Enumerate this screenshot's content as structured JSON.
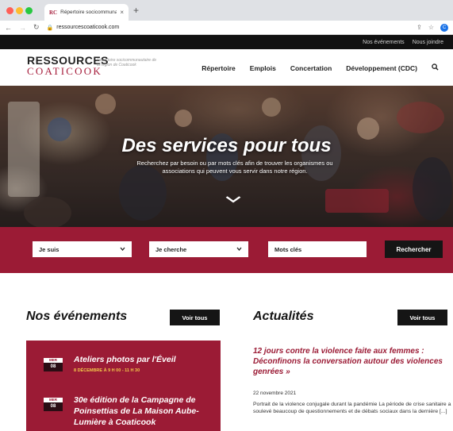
{
  "browser": {
    "tab_favicon": "RC",
    "tab_title": "Répertoire socicommunautai",
    "tab_close": "×",
    "new_tab": "+",
    "url": "ressourcescoaticook.com",
    "profile_initial": "C"
  },
  "topbar": {
    "links": [
      "Nos événements",
      "Nous joindre"
    ]
  },
  "logo": {
    "main": "RESSOURCES",
    "sub": "COATICOOK",
    "tagline": "Répertoire socicommunautaire de la région de Coaticook"
  },
  "nav": {
    "items": [
      "Répertoire",
      "Emplois",
      "Concertation",
      "Développement (CDC)"
    ]
  },
  "hero": {
    "title": "Des services pour tous",
    "subtitle": "Recherchez par besoin ou par mots clés afin de trouver les organismes ou associations qui peuvent vous servir dans notre région."
  },
  "search": {
    "select1": "Je suis",
    "select2": "Je cherche",
    "keywords_placeholder": "Mots clés",
    "button": "Rechercher"
  },
  "events": {
    "title": "Nos événements",
    "see_all": "Voir tous",
    "items": [
      {
        "month": "MER",
        "day": "08",
        "title": "Ateliers photos par l'Éveil",
        "date": "8 DÉCEMBRE À 9 H 00 - 11 H 30"
      },
      {
        "month": "MER",
        "day": "08",
        "title": "30e édition de la Campagne de Poinsettias de La Maison Aube-Lumière à Coaticook",
        "date": ""
      }
    ]
  },
  "news": {
    "title": "Actualités",
    "see_all": "Voir tous",
    "article_title": "12 jours contre la violence faite aux femmes : Déconfinons la conversation autour des violences genrées »",
    "article_date": "22 novembre 2021",
    "article_excerpt": "Portrait de la violence conjugale durant la pandémie La période de crise sanitaire a soulevé beaucoup de questionnements et de débats sociaux dans la dernière [...]"
  },
  "colors": {
    "brand": "#9b1b35",
    "dark": "#151515",
    "accent_yellow": "#f2c84b"
  }
}
